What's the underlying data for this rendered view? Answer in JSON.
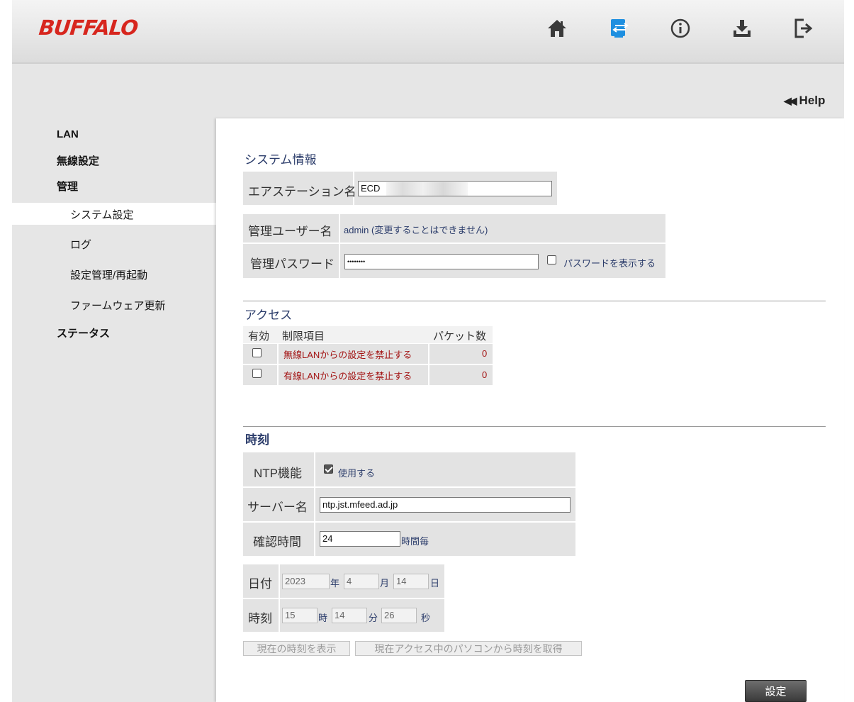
{
  "header": {
    "logo": "BUFFALO",
    "icons": [
      "home-icon",
      "settings-icon",
      "info-icon",
      "download-icon",
      "logout-icon"
    ]
  },
  "help_label": "Help",
  "nav": {
    "lan": "LAN",
    "wireless": "無線設定",
    "admin": "管理",
    "system": "システム設定",
    "log": "ログ",
    "config": "設定管理/再起動",
    "firmware": "ファームウェア更新",
    "status": "ステータス"
  },
  "system_info": {
    "title": "システム情報",
    "station_label": "エアステーション名",
    "station_value": "ECD",
    "user_label": "管理ユーザー名",
    "user_value": "admin (変更することはできません)",
    "password_label": "管理パスワード",
    "password_value": "••••••••",
    "show_password": "パスワードを表示する"
  },
  "access": {
    "title": "アクセス",
    "col_enable": "有効",
    "col_item": "制限項目",
    "col_packets": "パケット数",
    "rows": [
      {
        "item": "無線LANからの設定を禁止する",
        "packets": "0"
      },
      {
        "item": "有線LANからの設定を禁止する",
        "packets": "0"
      }
    ]
  },
  "time": {
    "title": "時刻",
    "ntp_label": "NTP機能",
    "ntp_use": "使用する",
    "server_label": "サーバー名",
    "server_value": "ntp.jst.mfeed.ad.jp",
    "interval_label": "確認時間",
    "interval_value": "24",
    "interval_unit": "時間毎",
    "date_label": "日付",
    "year": "2023",
    "year_unit": "年",
    "month": "4",
    "month_unit": "月",
    "day": "14",
    "day_unit": "日",
    "time_label": "時刻",
    "hour": "15",
    "hour_unit": "時",
    "minute": "14",
    "minute_unit": "分",
    "second": "26",
    "second_unit": "秒",
    "show_time_btn": "現在の時刻を表示",
    "get_time_btn": "現在アクセス中のパソコンから時刻を取得"
  },
  "submit_label": "設定"
}
